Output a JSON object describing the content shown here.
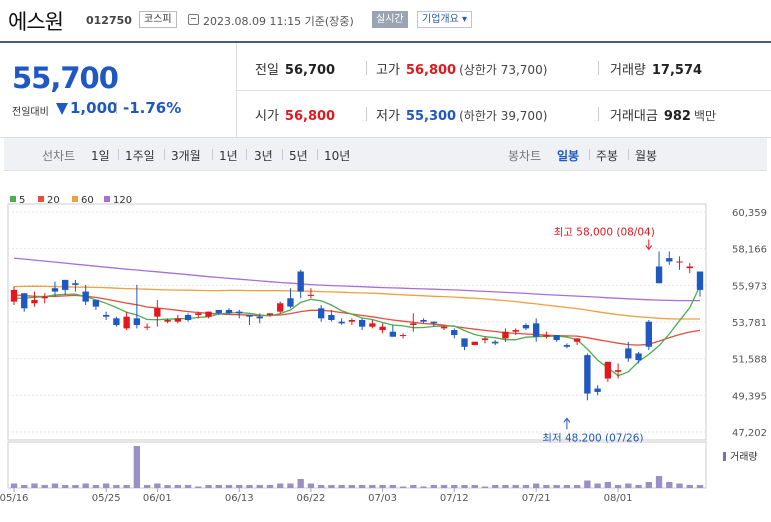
{
  "header": {
    "name": "에스원",
    "code": "012750",
    "market": "코스피",
    "datetime": "2023.08.09 11:15 기준(장중)",
    "realtime": "실시간",
    "company_info": "기업개요 ▾"
  },
  "price": {
    "current": "55,700",
    "compare_label": "전일대비",
    "change": "1,000",
    "rate": "-1.76%",
    "prev_label": "전일",
    "prev": "56,700",
    "high_label": "고가",
    "high": "56,800",
    "upper_limit": "(상한가 73,700)",
    "volume_label": "거래량",
    "volume": "17,574",
    "open_label": "시가",
    "open": "56,800",
    "low_label": "저가",
    "low": "55,300",
    "lower_limit": "(하한가 39,700)",
    "amount_label": "거래대금",
    "amount": "982",
    "amount_unit": "백만"
  },
  "periods": {
    "line_label": "선차트",
    "line": [
      "1일",
      "1주일",
      "3개월",
      "1년",
      "3년",
      "5년",
      "10년"
    ],
    "candle_label": "봉차트",
    "candle": [
      "일봉",
      "주봉",
      "월봉"
    ]
  },
  "colors": {
    "up": "#e1181e",
    "down": "#1f57c3",
    "ma5": "#4caf50",
    "ma20": "#e84c3d",
    "ma60": "#f0a040",
    "ma120": "#a86fd6"
  },
  "chart_data": {
    "type": "candlestick",
    "legend": [
      "5",
      "20",
      "60",
      "120"
    ],
    "yticks": [
      "60,359",
      "58,166",
      "55,973",
      "53,781",
      "51,588",
      "49,395",
      "47,202"
    ],
    "ylim": [
      47202,
      60359
    ],
    "xticks": [
      "05/16",
      "05/25",
      "06/01",
      "06/13",
      "06/22",
      "07/03",
      "07/12",
      "07/21",
      "08/01"
    ],
    "xtick_index": [
      0,
      9,
      14,
      22,
      29,
      36,
      43,
      51,
      59
    ],
    "volume_label": "거래량",
    "annotations": [
      {
        "text": "최고 58,000 (08/04)",
        "index": 62,
        "value": 58000
      },
      {
        "text": "최저 48,200 (07/26)",
        "index": 54,
        "value": 48200
      }
    ],
    "candles": [
      [
        55000,
        55900,
        54800,
        55700
      ],
      [
        55500,
        55500,
        54400,
        54600
      ],
      [
        54900,
        55600,
        54700,
        55100
      ],
      [
        55200,
        55500,
        54900,
        55300
      ],
      [
        55800,
        56200,
        55300,
        55600
      ],
      [
        56300,
        56300,
        55400,
        55700
      ],
      [
        56100,
        56300,
        55600,
        56000
      ],
      [
        55600,
        56000,
        54800,
        55000
      ],
      [
        55100,
        55100,
        54500,
        54700
      ],
      [
        54200,
        54400,
        53900,
        54100
      ],
      [
        54000,
        54100,
        53500,
        53600
      ],
      [
        53400,
        54400,
        53300,
        54100
      ],
      [
        54000,
        56000,
        53400,
        53600
      ],
      [
        53500,
        53700,
        53300,
        53500
      ],
      [
        54100,
        55100,
        53500,
        54600
      ],
      [
        53800,
        54000,
        53700,
        53900
      ],
      [
        53800,
        54200,
        53700,
        54000
      ],
      [
        54200,
        54300,
        53800,
        53900
      ],
      [
        54200,
        54400,
        54000,
        54300
      ],
      [
        54100,
        54400,
        54000,
        54400
      ],
      [
        54500,
        54500,
        54200,
        54300
      ],
      [
        54500,
        54600,
        54200,
        54300
      ],
      [
        54400,
        54500,
        54000,
        54300
      ],
      [
        54200,
        54200,
        53600,
        54100
      ],
      [
        54100,
        54300,
        53700,
        54000
      ],
      [
        54200,
        54300,
        54100,
        54300
      ],
      [
        54400,
        55000,
        54300,
        54900
      ],
      [
        55200,
        55800,
        54600,
        54700
      ],
      [
        56800,
        56900,
        55200,
        55600
      ],
      [
        55400,
        55800,
        55200,
        55400
      ],
      [
        54600,
        54800,
        53800,
        54000
      ],
      [
        54200,
        54500,
        53800,
        53900
      ],
      [
        53800,
        54000,
        53600,
        53700
      ],
      [
        53800,
        54000,
        53600,
        53900
      ],
      [
        53900,
        54000,
        53300,
        53500
      ],
      [
        53500,
        53900,
        53400,
        53700
      ],
      [
        53300,
        53700,
        53100,
        53500
      ],
      [
        53200,
        53600,
        52900,
        52900
      ],
      [
        53000,
        53100,
        52800,
        53000
      ],
      [
        53600,
        54300,
        53200,
        53700
      ],
      [
        53900,
        54000,
        53700,
        53800
      ],
      [
        53800,
        53800,
        53500,
        53700
      ],
      [
        53400,
        53600,
        53300,
        53500
      ],
      [
        53300,
        53400,
        52800,
        53000
      ],
      [
        52800,
        52800,
        52100,
        52300
      ],
      [
        52400,
        52600,
        52400,
        52600
      ],
      [
        52700,
        52900,
        52500,
        52800
      ],
      [
        52600,
        52700,
        52400,
        52500
      ],
      [
        52800,
        53400,
        52600,
        53200
      ],
      [
        53200,
        53400,
        53000,
        53300
      ],
      [
        53600,
        53700,
        53300,
        53400
      ],
      [
        53700,
        54000,
        52600,
        52900
      ],
      [
        52900,
        53200,
        52800,
        53000
      ],
      [
        53000,
        53000,
        52600,
        52700
      ],
      [
        52400,
        52500,
        52200,
        52300
      ],
      [
        52600,
        52800,
        52400,
        52800
      ],
      [
        51800,
        51900,
        49100,
        49500
      ],
      [
        49800,
        50000,
        49400,
        49600
      ],
      [
        50400,
        51400,
        50200,
        51400
      ],
      [
        50800,
        51300,
        50400,
        50900
      ],
      [
        52200,
        52600,
        51400,
        51600
      ],
      [
        51900,
        52000,
        51300,
        51500
      ],
      [
        53800,
        53900,
        52100,
        52300
      ],
      [
        57100,
        58000,
        56100,
        56100
      ],
      [
        57600,
        58000,
        57200,
        57400
      ],
      [
        57400,
        57700,
        56900,
        57400
      ],
      [
        57000,
        57300,
        56700,
        57100
      ],
      [
        56800,
        56800,
        55300,
        55700
      ]
    ],
    "ma5": [
      55200,
      55210,
      55250,
      55300,
      55400,
      55430,
      55450,
      55300,
      55100,
      54900,
      54650,
      54360,
      54200,
      53930,
      53920,
      53950,
      53970,
      53990,
      54050,
      54100,
      54260,
      54320,
      54340,
      54300,
      54200,
      54150,
      54280,
      54500,
      54950,
      55130,
      55050,
      54800,
      54450,
      54240,
      54020,
      53930,
      53750,
      53600,
      53550,
      53440,
      53450,
      53520,
      53540,
      53540,
      53270,
      53030,
      52900,
      52840,
      52720,
      52720,
      52870,
      52900,
      52930,
      52940,
      52880,
      52730,
      52160,
      51500,
      51040,
      50570,
      50800,
      51420,
      51840,
      52360,
      53060,
      53860,
      54640,
      55950
    ],
    "ma20": [
      55400,
      55360,
      55320,
      55300,
      55320,
      55340,
      55380,
      55320,
      55250,
      55150,
      55030,
      54910,
      54810,
      54680,
      54620,
      54550,
      54480,
      54400,
      54350,
      54300,
      54260,
      54230,
      54220,
      54190,
      54160,
      54170,
      54200,
      54280,
      54400,
      54480,
      54480,
      54430,
      54340,
      54260,
      54170,
      54090,
      53990,
      53900,
      53830,
      53760,
      53690,
      53650,
      53590,
      53520,
      53430,
      53350,
      53280,
      53210,
      53140,
      53100,
      53060,
      53030,
      52990,
      52970,
      52950,
      52940,
      52840,
      52720,
      52620,
      52510,
      52430,
      52400,
      52450,
      52640,
      52850,
      53030,
      53180,
      53280
    ],
    "ma60": [
      55900,
      55910,
      55920,
      55910,
      55900,
      55880,
      55870,
      55860,
      55850,
      55830,
      55800,
      55780,
      55760,
      55740,
      55720,
      55700,
      55690,
      55680,
      55670,
      55660,
      55660,
      55670,
      55670,
      55660,
      55650,
      55650,
      55650,
      55640,
      55630,
      55620,
      55600,
      55580,
      55560,
      55540,
      55520,
      55500,
      55470,
      55440,
      55410,
      55380,
      55350,
      55320,
      55300,
      55270,
      55230,
      55200,
      55160,
      55110,
      55060,
      55000,
      54930,
      54860,
      54790,
      54720,
      54650,
      54580,
      54490,
      54390,
      54300,
      54220,
      54150,
      54090,
      54050,
      54000,
      53970,
      53960,
      53960,
      53960
    ],
    "ma120": [
      57600,
      57540,
      57480,
      57420,
      57360,
      57300,
      57240,
      57180,
      57120,
      57060,
      57000,
      56940,
      56890,
      56830,
      56780,
      56720,
      56670,
      56610,
      56550,
      56490,
      56440,
      56390,
      56340,
      56290,
      56240,
      56190,
      56140,
      56100,
      56060,
      56020,
      55990,
      55960,
      55940,
      55910,
      55890,
      55860,
      55840,
      55820,
      55800,
      55780,
      55760,
      55740,
      55720,
      55700,
      55670,
      55640,
      55610,
      55580,
      55550,
      55520,
      55490,
      55450,
      55420,
      55390,
      55360,
      55330,
      55300,
      55270,
      55230,
      55200,
      55170,
      55140,
      55110,
      55090,
      55070,
      55060,
      55060,
      55060
    ],
    "volume": [
      3,
      2,
      3,
      2,
      3,
      2,
      2,
      3,
      2,
      3,
      2,
      2,
      28,
      2,
      3,
      2,
      2,
      2,
      1,
      2,
      2,
      2,
      2,
      2,
      2,
      2,
      3,
      3,
      6,
      3,
      2,
      2,
      2,
      2,
      2,
      2,
      2,
      2,
      1,
      2,
      1,
      2,
      2,
      2,
      2,
      2,
      1,
      2,
      2,
      2,
      2,
      3,
      2,
      2,
      2,
      2,
      5,
      3,
      4,
      2,
      3,
      2,
      4,
      8,
      4,
      3,
      2,
      2
    ]
  }
}
